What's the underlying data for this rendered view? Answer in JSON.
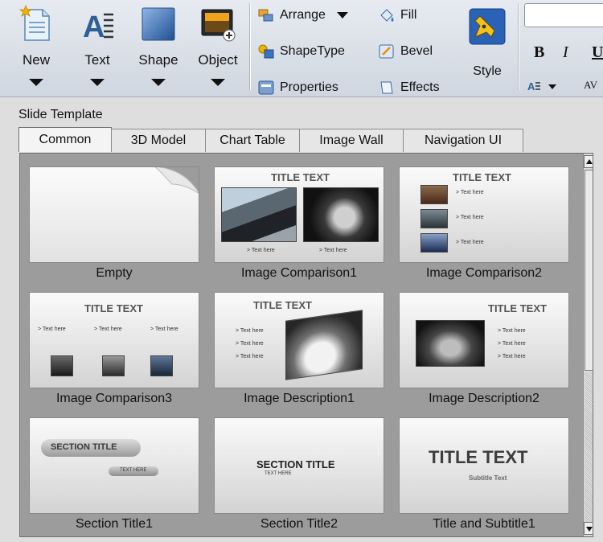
{
  "ribbon": {
    "big_buttons": [
      {
        "label": "New",
        "icon": "new-document-icon"
      },
      {
        "label": "Text",
        "icon": "text-icon"
      },
      {
        "label": "Shape",
        "icon": "shape-icon"
      },
      {
        "label": "Object",
        "icon": "object-icon"
      }
    ],
    "small_buttons": [
      {
        "label": "Arrange",
        "icon": "arrange-icon",
        "dropdown": true
      },
      {
        "label": "ShapeType",
        "icon": "shape-type-icon"
      },
      {
        "label": "Properties",
        "icon": "properties-icon"
      },
      {
        "label": "Fill",
        "icon": "fill-icon"
      },
      {
        "label": "Bevel",
        "icon": "bevel-icon"
      },
      {
        "label": "Effects",
        "icon": "effects-icon"
      }
    ],
    "style_label": "Style",
    "format": {
      "bold": "B",
      "italic": "I",
      "underline": "U",
      "av": "AV"
    }
  },
  "panel": {
    "title": "Slide Template",
    "tabs": [
      "Common",
      "3D Model",
      "Chart Table",
      "Image Wall",
      "Navigation UI"
    ],
    "active_tab": "Common",
    "templates": [
      {
        "label": "Empty",
        "title_text": ""
      },
      {
        "label": "Image Comparison1",
        "title_text": "TITLE TEXT",
        "bullets": [
          "> Text here",
          "> Text here"
        ]
      },
      {
        "label": "Image Comparison2",
        "title_text": "TITLE TEXT",
        "bullets": [
          "> Text here",
          "> Text here",
          "> Text here"
        ]
      },
      {
        "label": "Image Comparison3",
        "title_text": "TITLE TEXT",
        "bullets": [
          "> Text here",
          "> Text here",
          "> Text here"
        ]
      },
      {
        "label": "Image Description1",
        "title_text": "TITLE TEXT",
        "bullets": [
          "> Text here",
          "> Text here",
          "> Text here"
        ]
      },
      {
        "label": "Image Description2",
        "title_text": "TITLE TEXT",
        "bullets": [
          "> Text here",
          "> Text here",
          "> Text here"
        ]
      },
      {
        "label": "Section Title1",
        "title_text": "SECTION TITLE",
        "sub_text": "TEXT HERE"
      },
      {
        "label": "Section Title2",
        "title_text": "SECTION TITLE",
        "sub_text": "TEXT HERE"
      },
      {
        "label": "Title and Subtitle1",
        "title_text": "TITLE TEXT",
        "sub_text": "Subtitle Text"
      }
    ]
  }
}
